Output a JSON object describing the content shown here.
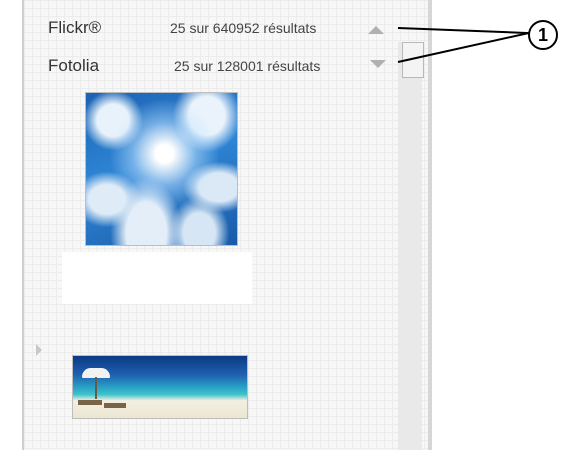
{
  "sources": [
    {
      "name": "Flickr®",
      "results": "25 sur 640952 résultats"
    },
    {
      "name": "Fotolia",
      "results": "25 sur  128001 résultats"
    }
  ],
  "callout": {
    "number": "1"
  },
  "colors": {
    "panel_bg": "#f7f7f7",
    "arrow": "#b0b0b0",
    "text": "#333333"
  }
}
